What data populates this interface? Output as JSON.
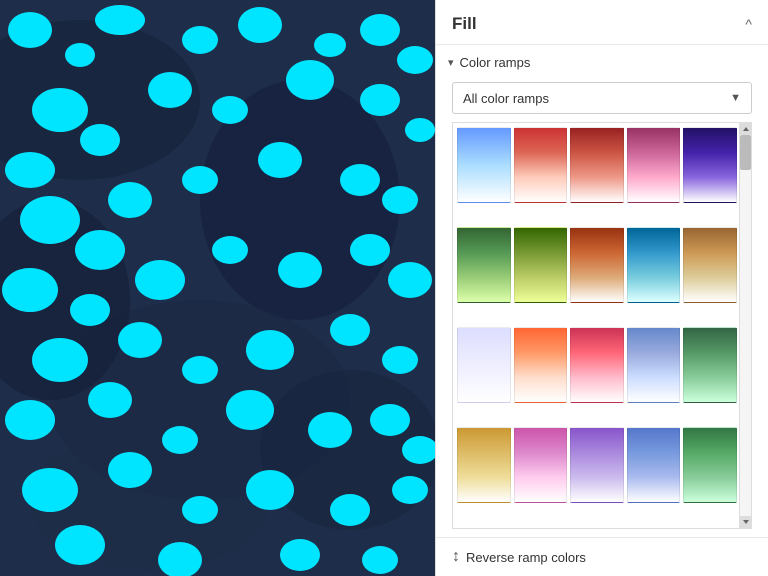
{
  "panel": {
    "title": "Fill",
    "collapse_label": "^",
    "section": {
      "label": "Color ramps",
      "arrow": "▾"
    },
    "dropdown": {
      "value": "All color ramps",
      "placeholder": "All color ramps",
      "arrow": "▼"
    },
    "footer": {
      "reverse_icon": "↕",
      "reverse_label": "Reverse ramp colors"
    }
  },
  "ramps": [
    {
      "id": 1,
      "class": "ramp-1"
    },
    {
      "id": 2,
      "class": "ramp-2"
    },
    {
      "id": 3,
      "class": "ramp-3"
    },
    {
      "id": 4,
      "class": "ramp-4"
    },
    {
      "id": 5,
      "class": "ramp-5"
    },
    {
      "id": 6,
      "class": "ramp-6"
    },
    {
      "id": 7,
      "class": "ramp-7"
    },
    {
      "id": 8,
      "class": "ramp-8"
    },
    {
      "id": 9,
      "class": "ramp-9"
    },
    {
      "id": 10,
      "class": "ramp-10"
    },
    {
      "id": 11,
      "class": "ramp-11"
    },
    {
      "id": 12,
      "class": "ramp-12"
    },
    {
      "id": 13,
      "class": "ramp-13"
    },
    {
      "id": 14,
      "class": "ramp-14"
    },
    {
      "id": 15,
      "class": "ramp-15"
    },
    {
      "id": 16,
      "class": "ramp-16"
    },
    {
      "id": 17,
      "class": "ramp-17"
    },
    {
      "id": 18,
      "class": "ramp-18"
    },
    {
      "id": 19,
      "class": "ramp-19"
    },
    {
      "id": 20,
      "class": "ramp-20"
    }
  ]
}
